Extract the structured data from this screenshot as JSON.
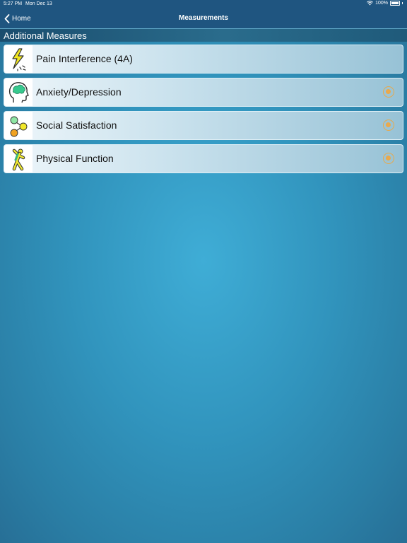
{
  "status": {
    "time": "5:27 PM",
    "date": "Mon Dec 13",
    "battery": "100%"
  },
  "nav": {
    "back_label": "Home",
    "title": "Measurements"
  },
  "section": {
    "title": "Additional Measures"
  },
  "items": [
    {
      "label": "Pain Interference (4A)",
      "icon": "lightning-pain-icon",
      "has_radio": false
    },
    {
      "label": "Anxiety/Depression",
      "icon": "head-brain-icon",
      "has_radio": true
    },
    {
      "label": "Social Satisfaction",
      "icon": "social-network-icon",
      "has_radio": true
    },
    {
      "label": "Physical Function",
      "icon": "person-stretching-icon",
      "has_radio": true
    }
  ],
  "colors": {
    "nav_bg": "#1f5580",
    "radio_accent": "#e9a94d"
  }
}
